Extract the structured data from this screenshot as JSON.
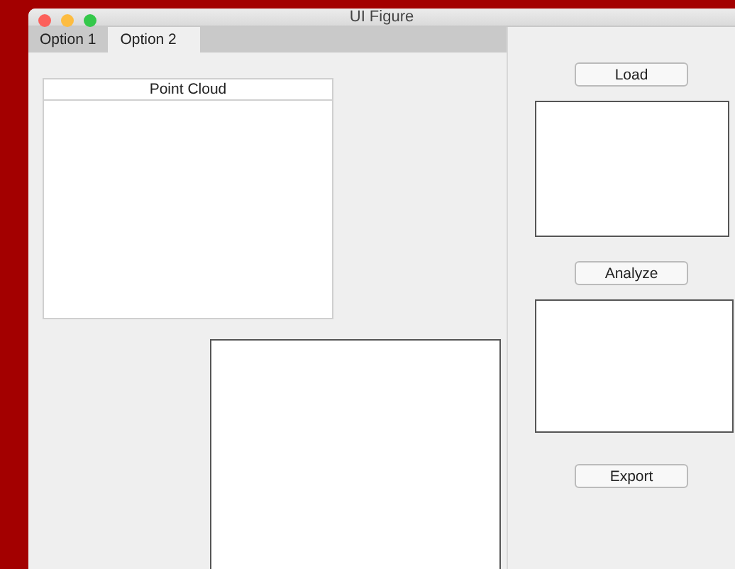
{
  "window": {
    "title": "UI Figure"
  },
  "tabs": [
    {
      "label": "Option 1",
      "selected": false
    },
    {
      "label": "Option 2",
      "selected": true
    }
  ],
  "panel": {
    "title": "Point Cloud"
  },
  "buttons": [
    "Load",
    "Analyze",
    "Export"
  ]
}
